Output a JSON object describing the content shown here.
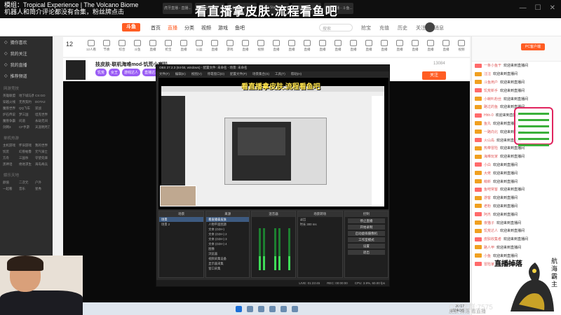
{
  "overlay": {
    "title_line1": "模组：Tropical Experience | The Volcano Biome",
    "title_line2": "机器人和简介评论都没有合集，粉丝牌点击",
    "tabs": [
      "虎牙直播 - 直播...",
      "Skin Game...",
      "斗鱼 - 每个人...",
      "Don't Starve Togeth...",
      "视频 - 斗鱼...",
      "斗鱼直播 - 斗鱼..."
    ],
    "banner": "看直播拿皮肤.流程看鱼吧"
  },
  "nav": {
    "logo": "斗鱼",
    "items": [
      "首页",
      "直播",
      "分类",
      "视频",
      "游戏",
      "鱼吧"
    ],
    "search_placeholder": "搜索",
    "icons": [
      "抢宝",
      "充值",
      "历史",
      "关注",
      "消息"
    ]
  },
  "sidebar": {
    "top_items": [
      "猜你喜欢",
      "我的关注",
      "我的直播",
      "推荐频道"
    ],
    "section1": "网游竞技",
    "section1_items": [
      "英雄联盟",
      "地下城与勇士",
      "CS:GO",
      "穿越火线",
      "无畏契约",
      "DOTA2",
      "魔兽世界",
      "QQ飞车",
      "逆战",
      "炉石传说",
      "梦三国",
      "坦克世界",
      "魔兽争霸",
      "问道",
      "永劫无间",
      "剑网3",
      "CF手游",
      "天涯明月刀"
    ],
    "section2": "单机热游",
    "section2_items": [
      "主机游戏",
      "怀旧游戏",
      "我的世界",
      "饥荒",
      "幻兽帕鲁",
      "元气骑士",
      "方舟",
      "三国杀",
      "守望先锋",
      "黑神话",
      "绝地求生",
      "海岛奇兵"
    ],
    "section3": "娱乐天地",
    "section3_items": [
      "颜值",
      "二次元",
      "户外",
      "一起看",
      "音乐",
      "星秀"
    ]
  },
  "category_bar": {
    "count": "12",
    "items": [
      "12人看",
      "节奏",
      "综合",
      "斗鱼",
      "直播",
      "抢宝",
      "直播",
      "公益",
      "直播",
      "游戏",
      "直播",
      "视频",
      "直播",
      "直播",
      "直播",
      "直播",
      "直播",
      "直播",
      "直播",
      "直播",
      "直播",
      "直播",
      "直播",
      "直播",
      "视频"
    ]
  },
  "room": {
    "title": "技皮肤-联机海难mod-饥荒小喇叭",
    "tags": [
      "饥荒",
      "女王",
      "游戏达人",
      "直播达人"
    ],
    "follow": "关注",
    "stats": "13084"
  },
  "obs": {
    "title": "OBS 27.2.3 (64-bit, windows) - 配置文件: 未命名 - 场景: 未命名",
    "menu": [
      "文件(F)",
      "编辑(E)",
      "视图(V)",
      "停靠窗口(D)",
      "配置文件(P)",
      "场景集合(S)",
      "工具(T)",
      "帮助(H)"
    ],
    "nested_banner": "看直播拿皮肤.流程看鱼吧",
    "docks": {
      "scenes_header": "场景",
      "scenes": [
        "场景",
        "场景 2"
      ],
      "sources_header": "来源",
      "sources": [
        "看直播拿皮肤",
        "人物平面图源",
        "文本 (GDI+)",
        "文本 (GDI+) 2",
        "文本 (GDI+) 3",
        "文本 (GDI+) 4",
        "图像",
        "浏览器",
        "视频采集设备",
        "显示器采集",
        "窗口采集"
      ],
      "mixer_header": "混音器",
      "transitions_header": "场景转场",
      "transition_value": "淡出",
      "duration_label": "时长",
      "duration_value": "300 ms",
      "controls_header": "控制",
      "controls": [
        "停止直播",
        "开始录制",
        "启动虚拟摄像机",
        "工作室模式",
        "设置",
        "退出"
      ]
    },
    "status": [
      "LIVE: 01:23:45",
      "REC: 00:00:00",
      "CPU: 3.9%, 60.00 fps"
    ]
  },
  "taskbar": {
    "time": "20:17",
    "date": "2024/3/5"
  },
  "chat": {
    "pc_button": "PC客户端",
    "rows": [
      {
        "lv": "1",
        "name": "一条小鱼干",
        "msg": "欢迎来到直播间"
      },
      {
        "lv": "2",
        "name": "汪汪",
        "msg": "欢迎来到直播间"
      },
      {
        "lv": "1",
        "name": "斗鱼用户",
        "msg": "欢迎来到直播间"
      },
      {
        "lv": "3",
        "name": "饥荒新手",
        "msg": "欢迎来到直播间"
      },
      {
        "lv": "1",
        "name": "小喇叭粉丝",
        "msg": "欢迎来到直播间"
      },
      {
        "lv": "5",
        "name": "路过的鱼",
        "msg": "欢迎来到直播间"
      },
      {
        "lv": "2",
        "name": "Hhh-0",
        "msg": "欢迎来到直播间"
      },
      {
        "lv": "4",
        "name": "鱼丸",
        "msg": "欢迎来到直播间"
      },
      {
        "lv": "1",
        "name": "一路向北",
        "msg": "欢迎来到直播间"
      },
      {
        "lv": "3",
        "name": "火山岛",
        "msg": "欢迎来到直播间"
      },
      {
        "lv": "1",
        "name": "热带冒险",
        "msg": "欢迎来到直播间"
      },
      {
        "lv": "2",
        "name": "海难玩家",
        "msg": "欢迎来到直播间"
      },
      {
        "lv": "1",
        "name": "小白",
        "msg": "欢迎来到直播间"
      },
      {
        "lv": "6",
        "name": "大佬",
        "msg": "欢迎来到直播间"
      },
      {
        "lv": "1",
        "name": "萌新",
        "msg": "欢迎来到直播间"
      },
      {
        "lv": "2",
        "name": "鱼吧常客",
        "msg": "欢迎来到直播间"
      },
      {
        "lv": "1",
        "name": "游客",
        "msg": "欢迎来到直播间"
      },
      {
        "lv": "3",
        "name": "老粉",
        "msg": "欢迎来到直播间"
      },
      {
        "lv": "1",
        "name": "阿杰",
        "msg": "欢迎来到直播间"
      },
      {
        "lv": "2",
        "name": "夜猫子",
        "msg": "欢迎来到直播间"
      },
      {
        "lv": "1",
        "name": "饥荒达人",
        "msg": "欢迎来到直播间"
      },
      {
        "lv": "4",
        "name": "皮肤收集者",
        "msg": "欢迎来到直播间"
      },
      {
        "lv": "1",
        "name": "路人甲",
        "msg": "欢迎来到直播间"
      },
      {
        "lv": "2",
        "name": "小鱼",
        "msg": "欢迎来到直播间"
      },
      {
        "lv": "1",
        "name": "冒险家",
        "msg": "欢迎来到直播间"
      }
    ]
  },
  "bottom_overlay": {
    "dragon_label": "直播掉落",
    "vertical_text": "航海霸主",
    "group_text": "Q交流群:7575",
    "sub_text": "皮肤 掉落 看直播"
  },
  "colors": {
    "accent": "#ff5d23",
    "overlay_bg": "#0f0f0f",
    "banner_text": "#ffffff",
    "nested_banner": "#ffe44d",
    "sidebar_bg": "#2d2d2d",
    "obs_bg": "#2b2b2b",
    "meter_green": "#3fdc58",
    "gift_border": "#e0245e"
  }
}
